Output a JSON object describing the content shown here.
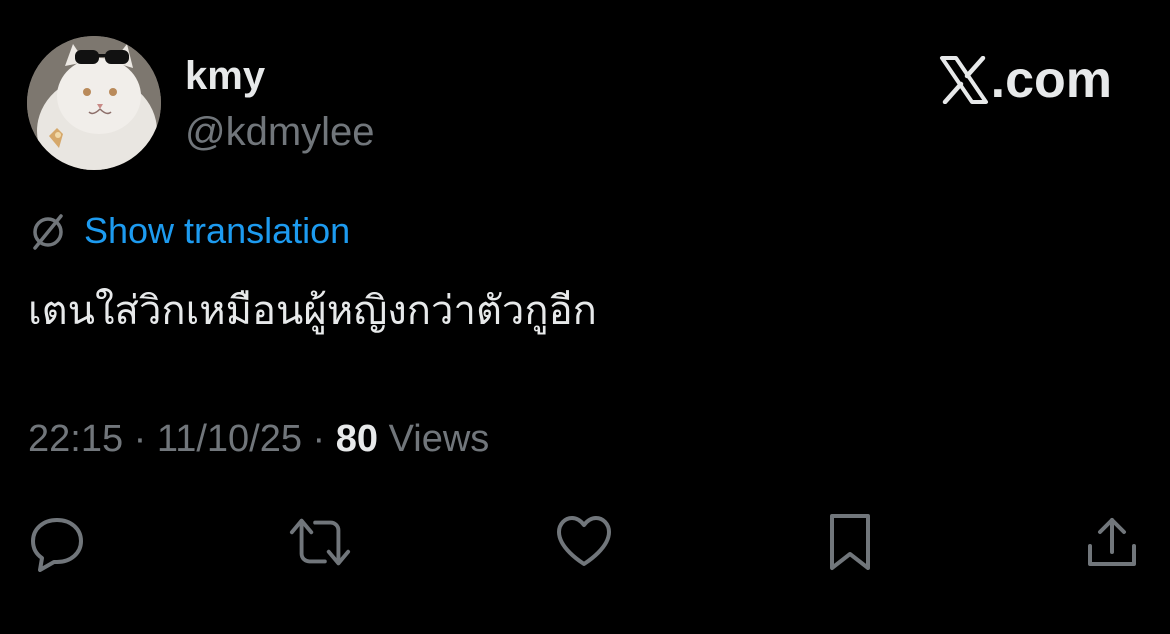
{
  "author": {
    "display_name": "kmy",
    "handle": "@kdmylee",
    "avatar_icon": "cat-avatar"
  },
  "brand": {
    "label": ".com",
    "mark": "X"
  },
  "translation": {
    "label": "Show translation",
    "icon": "translate-icon"
  },
  "tweet": {
    "text": "เตนใส่วิกเหมือนผู้หญิงกว่าตัวกูอีก"
  },
  "meta": {
    "time": "22:15",
    "separator": " · ",
    "date": "11/10/25",
    "views_count": "80",
    "views_label": " Views"
  },
  "actions": [
    {
      "name": "reply",
      "icon": "reply-icon"
    },
    {
      "name": "retweet",
      "icon": "retweet-icon"
    },
    {
      "name": "like",
      "icon": "heart-icon"
    },
    {
      "name": "bookmark",
      "icon": "bookmark-icon"
    },
    {
      "name": "share",
      "icon": "share-icon"
    }
  ],
  "colors": {
    "background": "#000000",
    "primary_text": "#e7e9ea",
    "secondary_text": "#71767b",
    "link": "#1d9bf0"
  }
}
